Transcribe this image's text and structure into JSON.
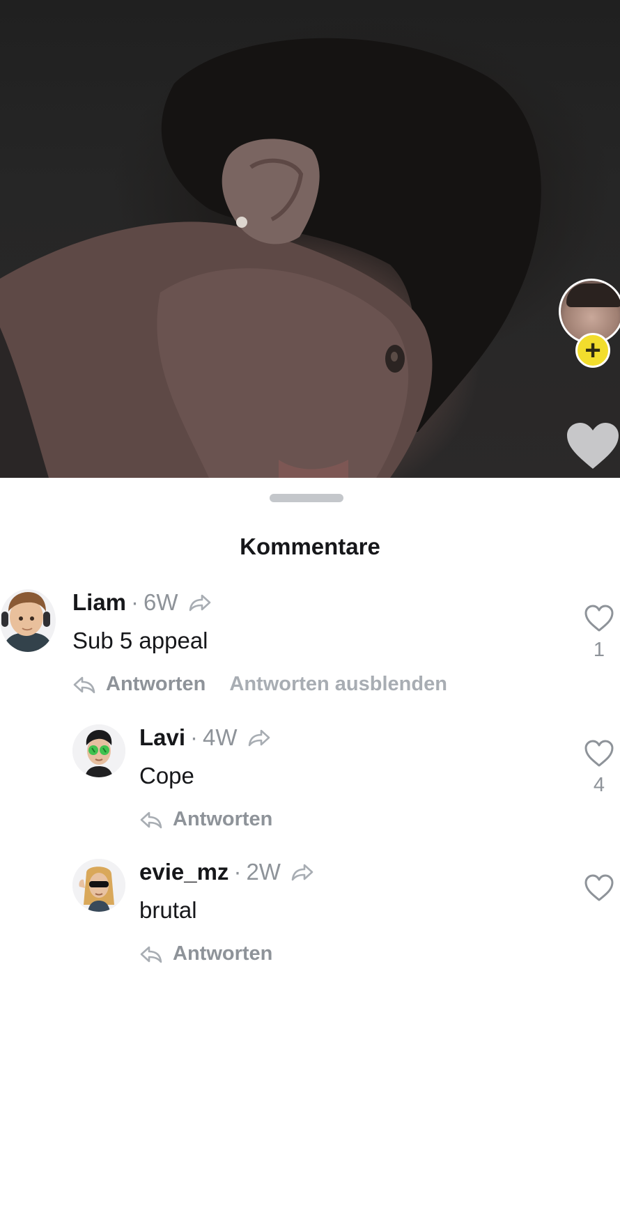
{
  "sheet": {
    "title": "Kommentare"
  },
  "comments": [
    {
      "username": "Liam",
      "age": "6W",
      "text": "Sub 5 appeal",
      "like_count": "1",
      "reply_label": "Antworten",
      "hide_replies_label": "Antworten ausblenden"
    },
    {
      "username": "Lavi",
      "age": "4W",
      "text": "Cope",
      "like_count": "4",
      "reply_label": "Antworten"
    },
    {
      "username": "evie_mz",
      "age": "2W",
      "text": "brutal",
      "like_count": "",
      "reply_label": "Antworten"
    }
  ],
  "colors": {
    "text_primary": "#16171a",
    "text_secondary": "#8e9399",
    "follow_badge": "#f2dd2d"
  },
  "icons": [
    "share-icon",
    "reply-icon",
    "heart-icon",
    "plus-icon"
  ]
}
